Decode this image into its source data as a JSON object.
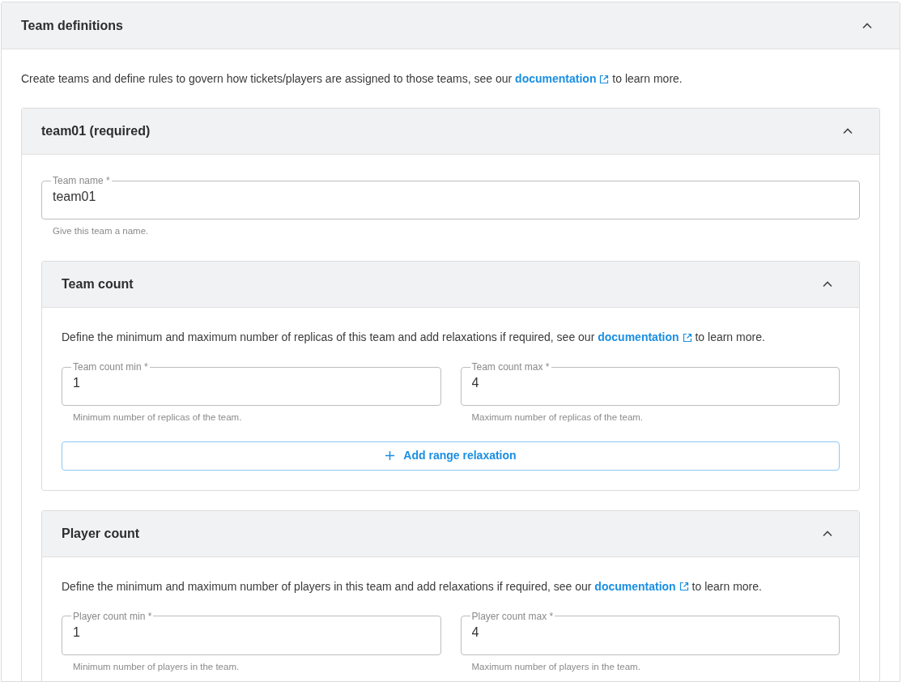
{
  "panel": {
    "title": "Team definitions",
    "expanded": true,
    "description": {
      "before": "Create teams and define rules to govern how tickets/players are assigned to those teams, see our",
      "link": "documentation",
      "after": "to learn more."
    },
    "teams": [
      {
        "title": "team01 (required)",
        "expanded": true,
        "name_field": {
          "label": "Team name *",
          "value": "team01",
          "helper": "Give this team a name."
        },
        "sections": [
          {
            "title": "Team count",
            "expanded": true,
            "description": {
              "before": "Define the minimum and maximum number of replicas of this team and add relaxations if required, see our",
              "link": "documentation",
              "after": "to learn more."
            },
            "fields": [
              {
                "label": "Team count min *",
                "value": "1",
                "helper": "Minimum number of replicas of the team."
              },
              {
                "label": "Team count max *",
                "value": "4",
                "helper": "Maximum number of replicas of the team."
              }
            ],
            "button": "Add range relaxation"
          },
          {
            "title": "Player count",
            "expanded": true,
            "description": {
              "before": "Define the minimum and maximum number of players in this team and add relaxations if required, see our",
              "link": "documentation",
              "after": "to learn more."
            },
            "fields": [
              {
                "label": "Player count min *",
                "value": "1",
                "helper": "Minimum number of players in the team."
              },
              {
                "label": "Player count max *",
                "value": "4",
                "helper": "Maximum number of players in the team."
              }
            ]
          }
        ]
      }
    ]
  }
}
